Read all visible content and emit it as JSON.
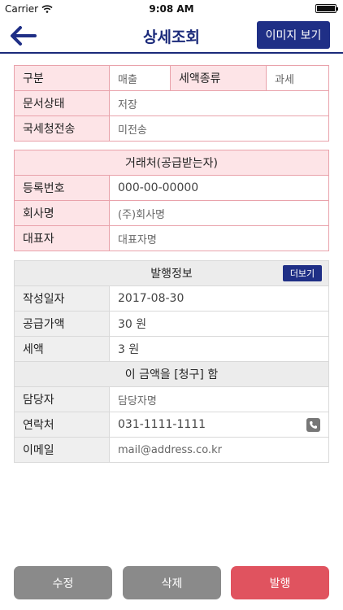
{
  "status_bar": {
    "carrier": "Carrier",
    "time": "9:08 AM"
  },
  "nav": {
    "title": "상세조회",
    "image_button": "이미지 보기"
  },
  "doc_info": {
    "type_label": "구분",
    "type_value": "매출",
    "tax_label": "세액종류",
    "tax_value": "과세",
    "state_label": "문서상태",
    "state_value": "저장",
    "nts_label": "국세청전송",
    "nts_value": "미전송"
  },
  "partner": {
    "header": "거래처(공급받는자)",
    "reg_label": "등록번호",
    "reg_value": "000-00-00000",
    "company_label": "회사명",
    "company_value": "(주)회사명",
    "ceo_label": "대표자",
    "ceo_value": "대표자명"
  },
  "issue": {
    "header": "발행정보",
    "more_button": "더보기",
    "date_label": "작성일자",
    "date_value": "2017-08-30",
    "supply_label": "공급가액",
    "supply_value": "30 원",
    "tax_label": "세액",
    "tax_value": "3 원",
    "claim_text": "이 금액을 [청구] 함",
    "manager_label": "담당자",
    "manager_value": "담당자명",
    "contact_label": "연락처",
    "contact_value": "031-1111-1111",
    "email_label": "이메일",
    "email_value": "mail@address.co.kr"
  },
  "buttons": {
    "edit": "수정",
    "delete": "삭제",
    "issue": "발행"
  },
  "colors": {
    "brand": "#1f2f86",
    "pink_border": "#e9a2ab",
    "pink_bg": "#fde4e7",
    "issue_red": "#e0535f"
  }
}
